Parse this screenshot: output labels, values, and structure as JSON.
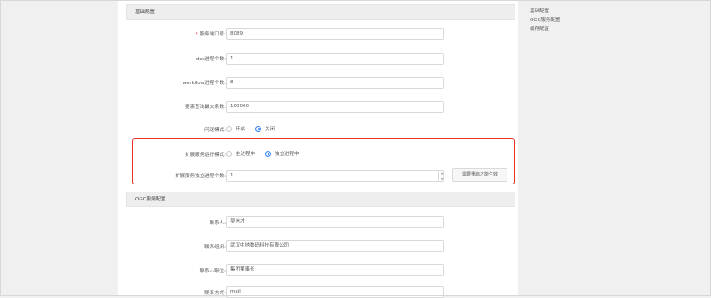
{
  "sections": {
    "basic": {
      "title": "基础配置"
    },
    "ogc": {
      "title": "OGC服务配置"
    }
  },
  "fields": {
    "port": {
      "label": "服务端口号:",
      "required": true,
      "value": "8089"
    },
    "dcs": {
      "label": "dcs进程个数:",
      "value": "1"
    },
    "workflow": {
      "label": "workflow进程个数:",
      "value": "8"
    },
    "max_query": {
      "label": "要素查询最大条数:",
      "value": "100000"
    },
    "fastmode": {
      "label": "闪速模式:",
      "options": [
        "开启",
        "关闭"
      ],
      "selected": 1
    },
    "ext_mode": {
      "label": "扩展服务运行模式:",
      "options": [
        "主进程中",
        "独立进程中"
      ],
      "selected": 1
    },
    "ext_count": {
      "label": "扩展服务独立进程个数:",
      "value": "1",
      "button": "需要重启才能生效"
    },
    "contact": {
      "label": "联系人:",
      "value": "吴信才"
    },
    "org": {
      "label": "联系组织:",
      "value": "武汉中地数码科技有限公司"
    },
    "position": {
      "label": "联系人职位:",
      "value": "集团董事长"
    },
    "method": {
      "label": "联系方式:",
      "value": "mail"
    }
  },
  "anchor_nav": [
    "基础配置",
    "OGC服务配置",
    "缓存配置"
  ],
  "colors": {
    "accent": "#2d7ff9",
    "highlight": "#e8332b",
    "required": "#e22233"
  }
}
